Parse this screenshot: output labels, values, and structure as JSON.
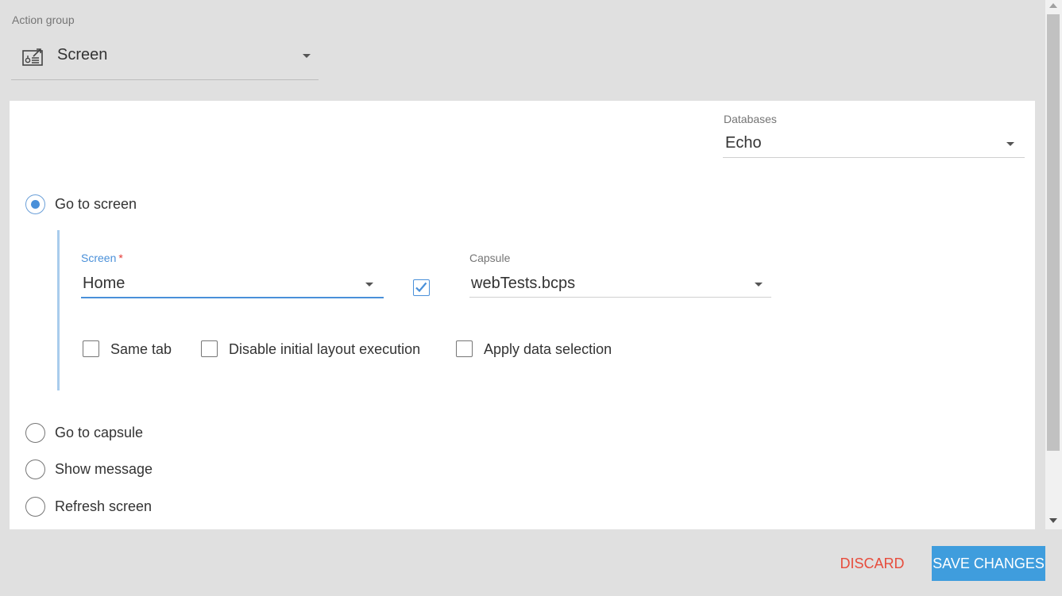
{
  "action_group": {
    "label": "Action group",
    "value": "Screen",
    "icon": "screen-action-icon"
  },
  "databases": {
    "label": "Databases",
    "value": "Echo"
  },
  "options": {
    "go_to_screen": "Go to screen",
    "go_to_capsule": "Go to capsule",
    "show_message": "Show message",
    "refresh_screen": "Refresh screen",
    "selected": "go_to_screen"
  },
  "screen_field": {
    "label": "Screen",
    "required_mark": "*",
    "value": "Home",
    "linked_checkbox_checked": true
  },
  "capsule_field": {
    "label": "Capsule",
    "value": "webTests.bcps"
  },
  "checkboxes": {
    "same_tab": "Same tab",
    "disable_initial_layout": "Disable initial layout execution",
    "apply_data_selection": "Apply data selection"
  },
  "footer": {
    "discard_label": "DISCARD",
    "save_label": "SAVE CHANGES"
  },
  "colors": {
    "accent": "#4a90d9",
    "save_button": "#3f9ddd",
    "discard_text": "#e74c3c",
    "background": "#e0e0e0"
  }
}
